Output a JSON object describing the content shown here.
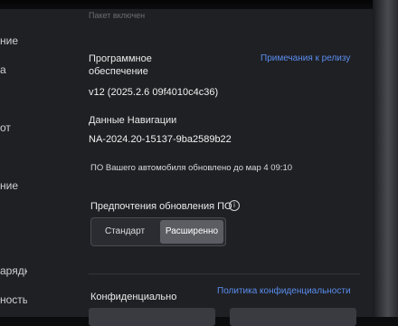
{
  "header": {
    "status_text": "Пакет включен"
  },
  "sidebar": {
    "items": [
      {
        "label": "ние"
      },
      {
        "label": "а"
      },
      {
        "label": "от"
      },
      {
        "label": "ние"
      },
      {
        "label": "арядки"
      },
      {
        "label": "ность"
      }
    ]
  },
  "software": {
    "title_line1": "Программное",
    "title_line2": "обеспечение",
    "release_notes_link": "Примечания к релизу",
    "version": "v12 (2025.2.6 09f4010c4c36)"
  },
  "navigation": {
    "title": "Данные Навигации",
    "value": "NA-2024.20-15137-9ba2589b22"
  },
  "update_status": "ПО Вашего автомобиля обновлено до мар 4 09:10",
  "update_preference": {
    "title": "Предпочтения обновления ПО",
    "info_icon": "info-icon",
    "options": [
      {
        "label": "Стандарт",
        "selected": false
      },
      {
        "label": "Расширенно",
        "selected": true
      }
    ]
  },
  "privacy": {
    "title": "Конфиденциально",
    "policy_link": "Политика конфиденциальности"
  },
  "colors": {
    "link": "#5a8dee",
    "background": "#1f2024",
    "selected_segment": "#5c5d63"
  }
}
